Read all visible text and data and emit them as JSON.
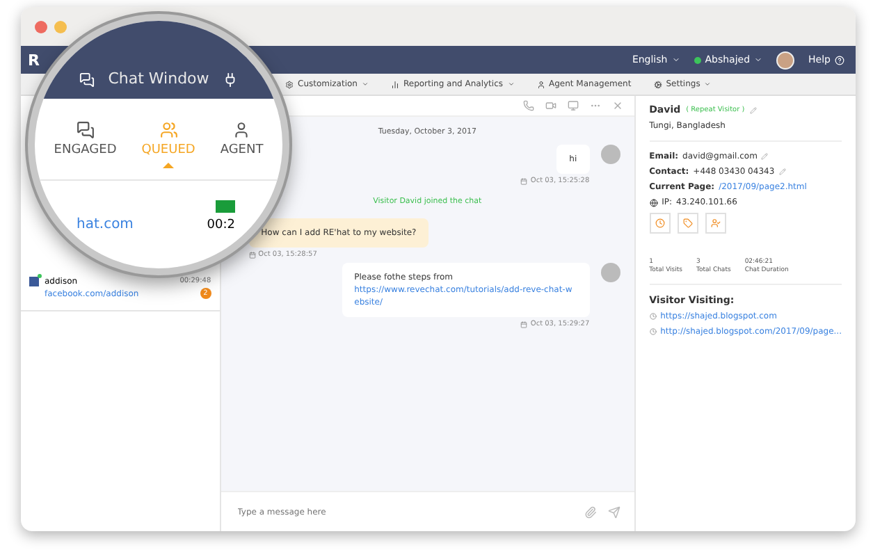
{
  "window": {
    "traffic_lights": [
      {
        "color": "#ee6b60"
      },
      {
        "color": "#f5be4f"
      }
    ]
  },
  "navbar": {
    "logo": "R",
    "language": "English",
    "user": {
      "name": "Abshajed",
      "online": true
    },
    "help": "Help"
  },
  "menu": [
    "Customization",
    "Reporting and Analytics",
    "Agent Management",
    "Settings"
  ],
  "magnifier": {
    "title": "Chat Window",
    "tabs": [
      {
        "label": "ENGAGED",
        "kind": "engaged",
        "selected": false
      },
      {
        "label": "QUEUED",
        "kind": "queued",
        "selected": true
      },
      {
        "label": "AGENT",
        "kind": "agent",
        "selected": false
      }
    ],
    "visitor": {
      "site": "hat.com",
      "time": "00:2"
    }
  },
  "queue": [
    {
      "name": "addison",
      "source": "facebook.com/addison",
      "time": "00:29:48",
      "badge": "2",
      "online": true
    }
  ],
  "chat": {
    "date": "Tuesday, October 3, 2017",
    "messages": [
      {
        "kind": "visitor",
        "text": "hi",
        "time": "Oct 03, 15:25:28"
      },
      {
        "kind": "event",
        "text": "Visitor David joined the chat"
      },
      {
        "kind": "agent",
        "text": "How can I add RE'hat to my website?",
        "time": "Oct 03, 15:28:57"
      },
      {
        "kind": "visitor",
        "text": "Please fothe steps from ",
        "link": "https://www.revechat.com/tutorials/add-reve-chat-website/",
        "time": "Oct 03, 15:29:27"
      }
    ],
    "input": {
      "placeholder": "Type a message here"
    }
  },
  "visitor": {
    "name": "David",
    "tag": "( Repeat Visitor )",
    "location": "Tungi, Bangladesh",
    "details": [
      {
        "label": "Email:",
        "value": "david@gmail.com",
        "kind": "editable"
      },
      {
        "label": "Contact:",
        "value": "+448 03430 04343",
        "kind": "editable"
      },
      {
        "label": "Current Page:",
        "value": "/2017/09/page2.html",
        "kind": "link"
      },
      {
        "label": "IP:",
        "value": "43.240.101.66",
        "kind": "ip"
      }
    ],
    "stats": [
      {
        "value": "1",
        "label": "Total Visits"
      },
      {
        "value": "3",
        "label": "Total Chats"
      },
      {
        "value": "02:46:21",
        "label": "Chat Duration"
      }
    ],
    "visiting_title": "Visitor Visiting:",
    "visiting": [
      "https://shajed.blogspot.com",
      "http://shajed.blogspot.com/2017/09/page..."
    ]
  }
}
